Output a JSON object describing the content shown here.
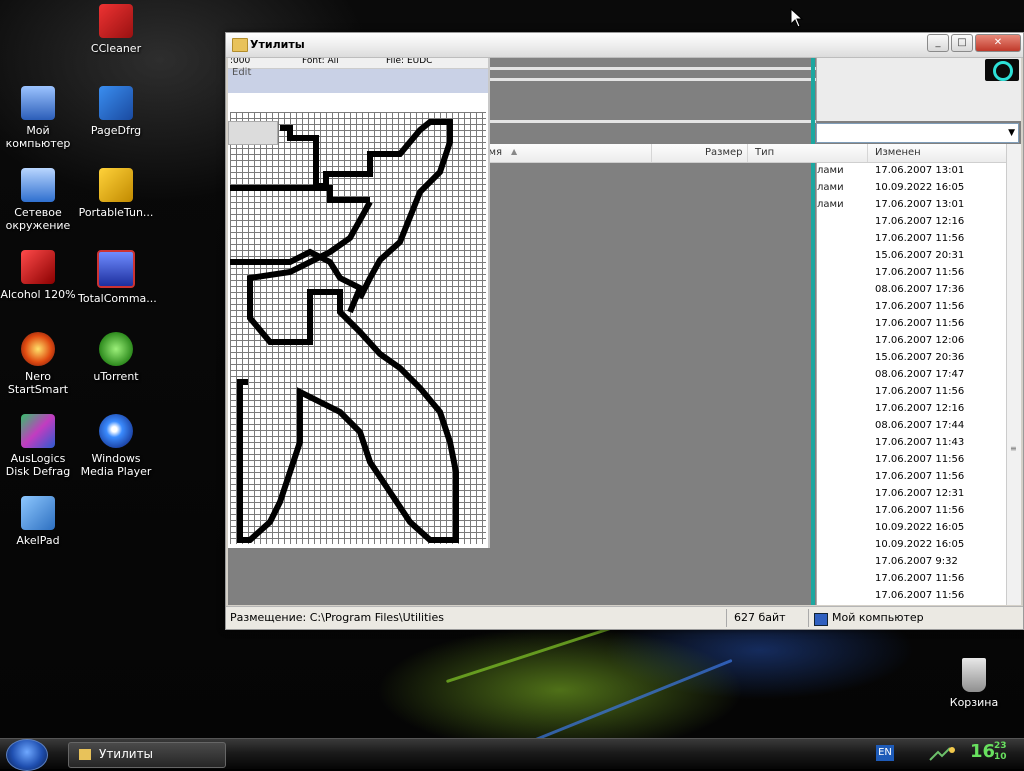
{
  "desktop": {
    "icons": [
      {
        "label": "CCleaner"
      },
      {
        "label": "Мой компьютер"
      },
      {
        "label": "PageDfrg"
      },
      {
        "label": "Сетевое окружение"
      },
      {
        "label": "PortableTun..."
      },
      {
        "label": "Alcohol 120%"
      },
      {
        "label": "TotalComma..."
      },
      {
        "label": "Nero StartSmart"
      },
      {
        "label": "uTorrent"
      },
      {
        "label": "AusLogics Disk Defrag"
      },
      {
        "label": "Windows Media Player"
      },
      {
        "label": "AkelPad"
      },
      {
        "label": "Корзина"
      }
    ]
  },
  "window": {
    "title": "Утилиты",
    "minimize": "_",
    "maximize": "□",
    "close": "✕"
  },
  "editor": {
    "top": {
      "code": ":000",
      "font": "Font: All",
      "file": "File: EUDC"
    },
    "menu": "Edit"
  },
  "list": {
    "columns": {
      "name": "Имя",
      "size": "Размер",
      "type": "Тип",
      "modified": "Изменен"
    },
    "sort_indicator": "▲",
    "rows": [
      {
        "type": "лами",
        "date": "17.06.2007 13:01"
      },
      {
        "type": "лами",
        "date": "10.09.2022 16:05"
      },
      {
        "type": "лами",
        "date": "17.06.2007 13:01"
      },
      {
        "type": "",
        "date": "17.06.2007 12:16"
      },
      {
        "type": "",
        "date": "17.06.2007 11:56"
      },
      {
        "type": "",
        "date": "15.06.2007 20:31"
      },
      {
        "type": "",
        "date": "17.06.2007 11:56"
      },
      {
        "type": "",
        "date": "08.06.2007 17:36"
      },
      {
        "type": "",
        "date": "17.06.2007 11:56"
      },
      {
        "type": "",
        "date": "17.06.2007 11:56"
      },
      {
        "type": "",
        "date": "17.06.2007 12:06"
      },
      {
        "type": "",
        "date": "15.06.2007 20:36"
      },
      {
        "type": "",
        "date": "08.06.2007 17:47"
      },
      {
        "type": "",
        "date": "17.06.2007 11:56"
      },
      {
        "type": "",
        "date": "17.06.2007 12:16"
      },
      {
        "type": "",
        "date": "08.06.2007 17:44"
      },
      {
        "type": "",
        "date": "17.06.2007 11:43"
      },
      {
        "type": "",
        "date": "17.06.2007 11:56"
      },
      {
        "type": "",
        "date": "17.06.2007 11:56"
      },
      {
        "type": "",
        "date": "17.06.2007 12:31"
      },
      {
        "type": "",
        "date": "17.06.2007 11:56"
      },
      {
        "type": "",
        "date": "10.09.2022 16:05"
      },
      {
        "type": "",
        "date": "10.09.2022 16:05"
      },
      {
        "type": "",
        "date": "17.06.2007 9:32"
      },
      {
        "type": "",
        "date": "17.06.2007 11:56"
      },
      {
        "type": "",
        "date": "17.06.2007 11:56"
      }
    ]
  },
  "statusbar": {
    "location": "Размещение: C:\\Program Files\\Utilities",
    "size": "627 байт",
    "zone": "Мой компьютер"
  },
  "taskbar": {
    "item": "Утилиты",
    "lang": "EN",
    "time_hour": "16",
    "time_min_a": "23",
    "time_min_b": "10"
  },
  "colors": {
    "tray_clock": "#68e05f",
    "accent_cyan": "#1ca7a0"
  }
}
